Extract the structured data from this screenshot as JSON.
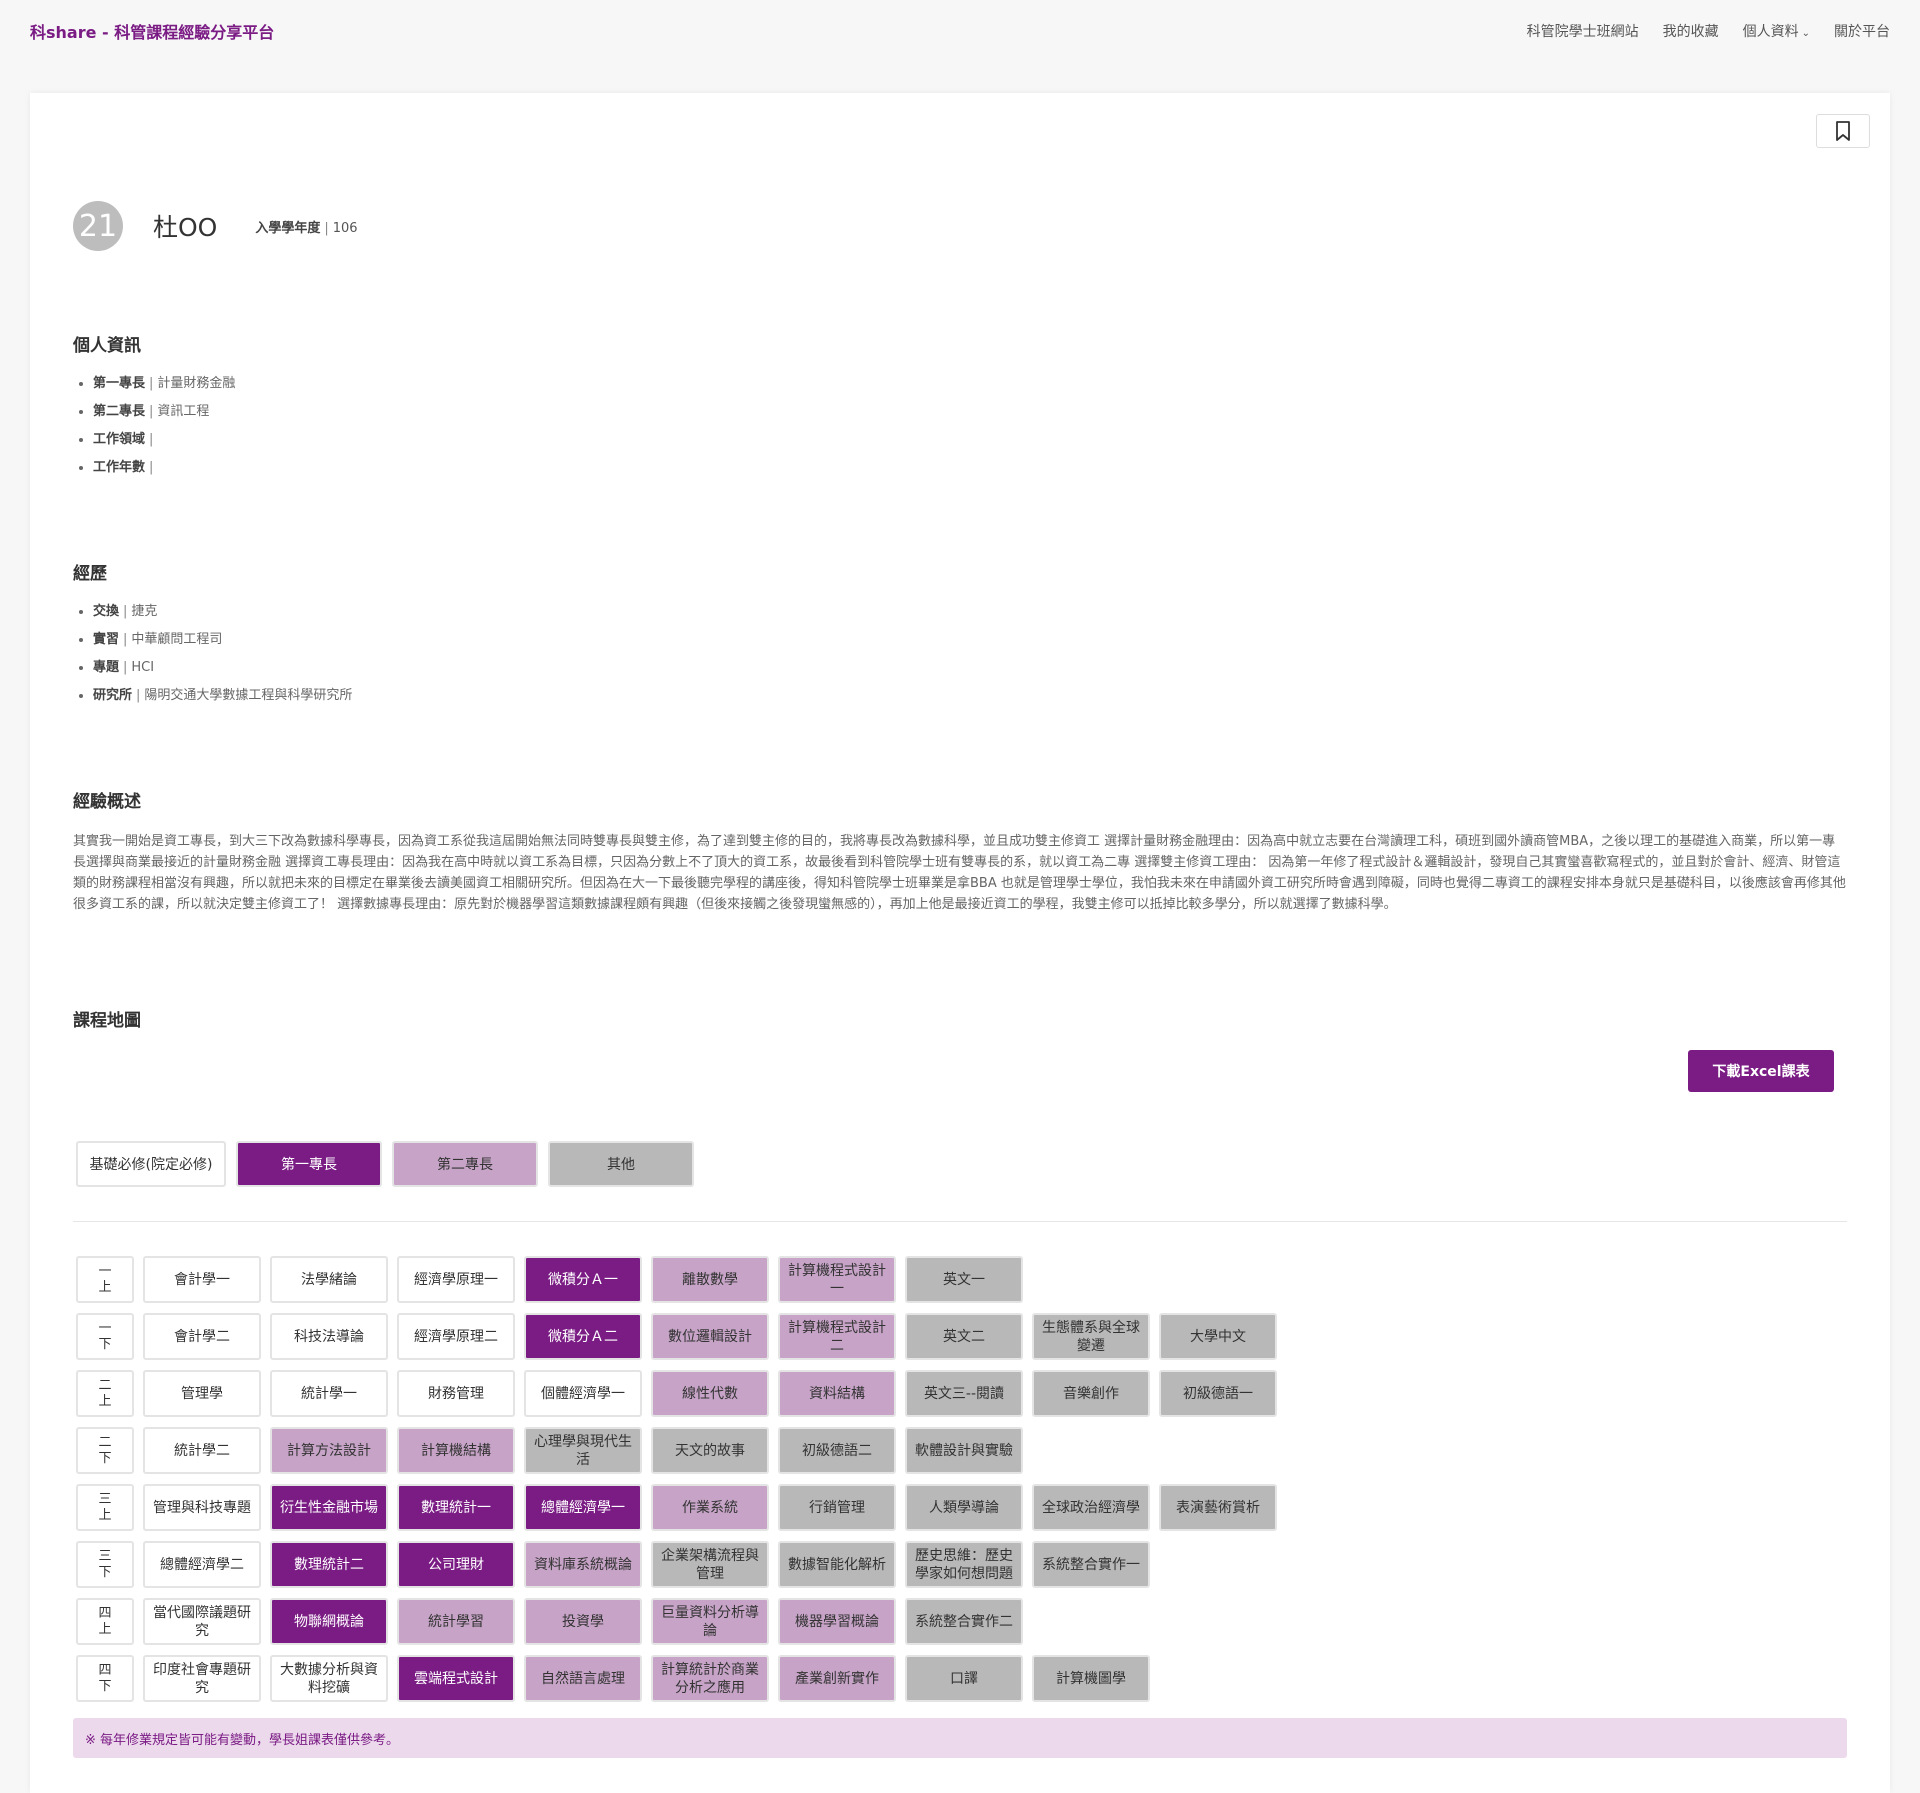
{
  "nav": {
    "brand": "科share - 科管課程經驗分享平台",
    "links": [
      "科管院學士班網站",
      "我的收藏",
      "個人資料",
      "關於平台"
    ]
  },
  "profile": {
    "avatar_text": "21",
    "name": "杜OO",
    "year_label": "入學學年度",
    "year_value": "106"
  },
  "personal": {
    "title": "個人資訊",
    "items": [
      {
        "label": "第一專長",
        "value": "計量財務金融"
      },
      {
        "label": "第二專長",
        "value": "資訊工程"
      },
      {
        "label": "工作領域",
        "value": ""
      },
      {
        "label": "工作年數",
        "value": ""
      }
    ]
  },
  "experience": {
    "title": "經歷",
    "items": [
      {
        "label": "交換",
        "value": "捷克"
      },
      {
        "label": "實習",
        "value": "中華顧問工程司"
      },
      {
        "label": "專題",
        "value": "HCI"
      },
      {
        "label": "研究所",
        "value": "陽明交通大學數據工程與科學研究所"
      }
    ]
  },
  "summary": {
    "title": "經驗概述",
    "text": "其實我一開始是資工專長，到大三下改為數據科學專長，因為資工系從我這屆開始無法同時雙專長與雙主修，為了達到雙主修的目的，我將專長改為數據科學，並且成功雙主修資工 選擇計量財務金融理由：因為高中就立志要在台灣讀理工科，碩班到國外讀商管MBA，之後以理工的基礎進入商業，所以第一專長選擇與商業最接近的計量財務金融 選擇資工專長理由：因為我在高中時就以資工系為目標，只因為分數上不了頂大的資工系，故最後看到科管院學士班有雙專長的系，就以資工為二專 選擇雙主修資工理由： 因為第一年修了程式設計＆邏輯設計，發現自己其實蠻喜歡寫程式的，並且對於會計、經濟、財管這類的財務課程相當沒有興趣，所以就把未來的目標定在畢業後去讀美國資工相關研究所。但因為在大一下最後聽完學程的講座後，得知科管院學士班畢業是拿BBA 也就是管理學士學位，我怕我未來在申請國外資工研究所時會遇到障礙，同時也覺得二專資工的課程安排本身就只是基礎科目，以後應該會再修其他很多資工系的課，所以就決定雙主修資工了！ 選擇數據專長理由：原先對於機器學習這類數據課程頗有興趣（但後來接觸之後發現蠻無感的），再加上他是最接近資工的學程，我雙主修可以抵掉比較多學分，所以就選擇了數據科學。"
  },
  "course_map": {
    "title": "課程地圖",
    "download_label": "下載Excel課表",
    "legend": [
      {
        "label": "基礎必修(院定必修)",
        "type": "white"
      },
      {
        "label": "第一專長",
        "type": "dark"
      },
      {
        "label": "第二專長",
        "type": "light"
      },
      {
        "label": "其他",
        "type": "gray"
      }
    ],
    "rows": [
      {
        "sem": [
          "一",
          "上"
        ],
        "courses": [
          {
            "name": "會計學一",
            "type": "white"
          },
          {
            "name": "法學緒論",
            "type": "white"
          },
          {
            "name": "經濟學原理一",
            "type": "white"
          },
          {
            "name": "微積分Ａ一",
            "type": "dark"
          },
          {
            "name": "離散數學",
            "type": "light"
          },
          {
            "name": "計算機程式設計一",
            "type": "light"
          },
          {
            "name": "英文一",
            "type": "gray"
          }
        ]
      },
      {
        "sem": [
          "一",
          "下"
        ],
        "courses": [
          {
            "name": "會計學二",
            "type": "white"
          },
          {
            "name": "科技法導論",
            "type": "white"
          },
          {
            "name": "經濟學原理二",
            "type": "white"
          },
          {
            "name": "微積分Ａ二",
            "type": "dark"
          },
          {
            "name": "數位邏輯設計",
            "type": "light"
          },
          {
            "name": "計算機程式設計二",
            "type": "light"
          },
          {
            "name": "英文二",
            "type": "gray"
          },
          {
            "name": "生態體系與全球變遷",
            "type": "gray"
          },
          {
            "name": "大學中文",
            "type": "gray"
          }
        ]
      },
      {
        "sem": [
          "二",
          "上"
        ],
        "courses": [
          {
            "name": "管理學",
            "type": "white"
          },
          {
            "name": "統計學一",
            "type": "white"
          },
          {
            "name": "財務管理",
            "type": "white"
          },
          {
            "name": "個體經濟學一",
            "type": "white"
          },
          {
            "name": "線性代數",
            "type": "light"
          },
          {
            "name": "資料結構",
            "type": "light"
          },
          {
            "name": "英文三--閱讀",
            "type": "gray"
          },
          {
            "name": "音樂創作",
            "type": "gray"
          },
          {
            "name": "初級德語一",
            "type": "gray"
          }
        ]
      },
      {
        "sem": [
          "二",
          "下"
        ],
        "courses": [
          {
            "name": "統計學二",
            "type": "white"
          },
          {
            "name": "計算方法設計",
            "type": "light"
          },
          {
            "name": "計算機結構",
            "type": "light"
          },
          {
            "name": "心理學與現代生活",
            "type": "gray"
          },
          {
            "name": "天文的故事",
            "type": "gray"
          },
          {
            "name": "初級德語二",
            "type": "gray"
          },
          {
            "name": "軟體設計與實驗",
            "type": "gray"
          }
        ]
      },
      {
        "sem": [
          "三",
          "上"
        ],
        "courses": [
          {
            "name": "管理與科技專題",
            "type": "white"
          },
          {
            "name": "衍生性金融市場",
            "type": "dark"
          },
          {
            "name": "數理統計一",
            "type": "dark"
          },
          {
            "name": "總體經濟學一",
            "type": "dark"
          },
          {
            "name": "作業系統",
            "type": "light"
          },
          {
            "name": "行銷管理",
            "type": "gray"
          },
          {
            "name": "人類學導論",
            "type": "gray"
          },
          {
            "name": "全球政治經濟學",
            "type": "gray"
          },
          {
            "name": "表演藝術賞析",
            "type": "gray"
          }
        ]
      },
      {
        "sem": [
          "三",
          "下"
        ],
        "courses": [
          {
            "name": "總體經濟學二",
            "type": "white"
          },
          {
            "name": "數理統計二",
            "type": "dark"
          },
          {
            "name": "公司理財",
            "type": "dark"
          },
          {
            "name": "資料庫系統概論",
            "type": "light"
          },
          {
            "name": "企業架構流程與管理",
            "type": "gray"
          },
          {
            "name": "數據智能化解析",
            "type": "gray"
          },
          {
            "name": "歷史思維：歷史學家如何想問題",
            "type": "gray"
          },
          {
            "name": "系統整合實作一",
            "type": "gray"
          }
        ]
      },
      {
        "sem": [
          "四",
          "上"
        ],
        "courses": [
          {
            "name": "當代國際議題研究",
            "type": "white"
          },
          {
            "name": "物聯網概論",
            "type": "dark"
          },
          {
            "name": "統計學習",
            "type": "light"
          },
          {
            "name": "投資學",
            "type": "light"
          },
          {
            "name": "巨量資料分析導論",
            "type": "light"
          },
          {
            "name": "機器學習概論",
            "type": "light"
          },
          {
            "name": "系統整合實作二",
            "type": "gray"
          }
        ]
      },
      {
        "sem": [
          "四",
          "下"
        ],
        "courses": [
          {
            "name": "印度社會專題研究",
            "type": "white"
          },
          {
            "name": "大數據分析與資料挖礦",
            "type": "white"
          },
          {
            "name": "雲端程式設計",
            "type": "dark"
          },
          {
            "name": "自然語言處理",
            "type": "light"
          },
          {
            "name": "計算統計於商業分析之應用",
            "type": "light"
          },
          {
            "name": "產業創新實作",
            "type": "light"
          },
          {
            "name": "口譯",
            "type": "gray"
          },
          {
            "name": "計算機圖學",
            "type": "gray"
          }
        ]
      }
    ],
    "note": "※ 每年修業規定皆可能有變動，學長姐課表僅供參考。"
  },
  "colors": {
    "primary": "#7b1c85",
    "second": "#c7a4c7",
    "other": "#b8b8b8",
    "note_bg": "#ecd9ec"
  }
}
